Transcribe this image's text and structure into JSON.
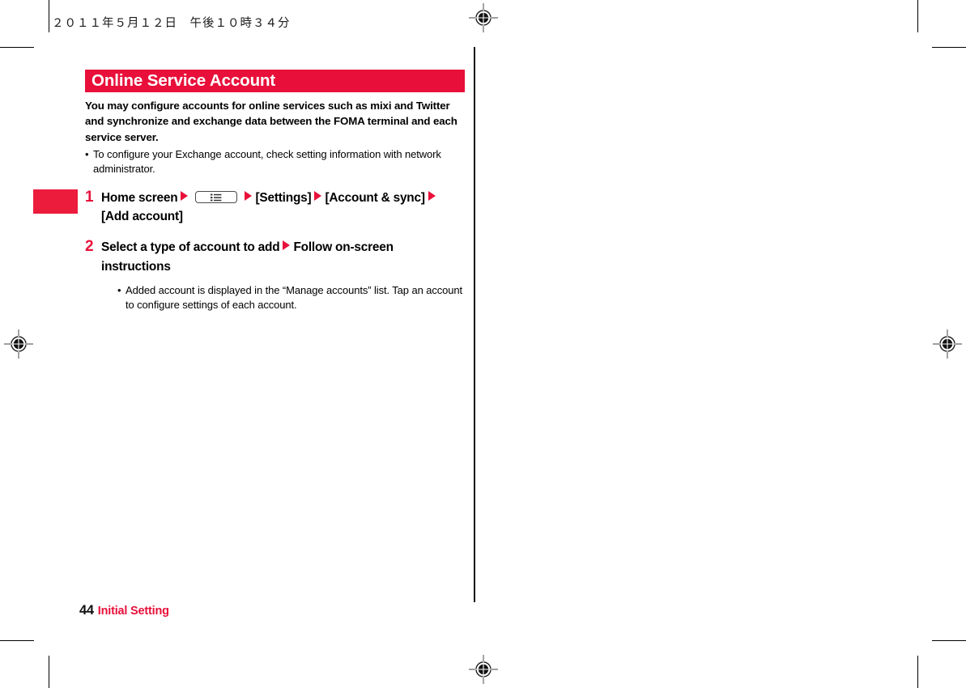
{
  "page": {
    "running_head": "２０１１年５月１２日　午後１０時３４分",
    "footer": {
      "page_number": "44",
      "chapter": "Initial Setting"
    },
    "colors": {
      "accent_red": "#e8103a",
      "tab_red": "#ec1c3c",
      "text_black": "#000000"
    }
  },
  "section": {
    "title": "Online Service Account",
    "lead": "You may configure accounts for online services such as mixi and Twitter and synchronize and exchange data between the FOMA terminal and each service server.",
    "bullet_marker": "•",
    "notes": [
      "To configure your Exchange account, check setting information with network administrator."
    ]
  },
  "steps": [
    {
      "number": "1",
      "part1": "Home screen",
      "key_icon": "menu-key-icon",
      "part2": "[Settings]",
      "part3": "[Account & sync]",
      "part4": "[Add account]",
      "notes": []
    },
    {
      "number": "2",
      "part1": "Select a type of account to add",
      "part2": "Follow on-screen instructions",
      "notes": [
        "Added account is displayed in the “Manage accounts” list. Tap an account to configure settings of each account."
      ]
    }
  ]
}
